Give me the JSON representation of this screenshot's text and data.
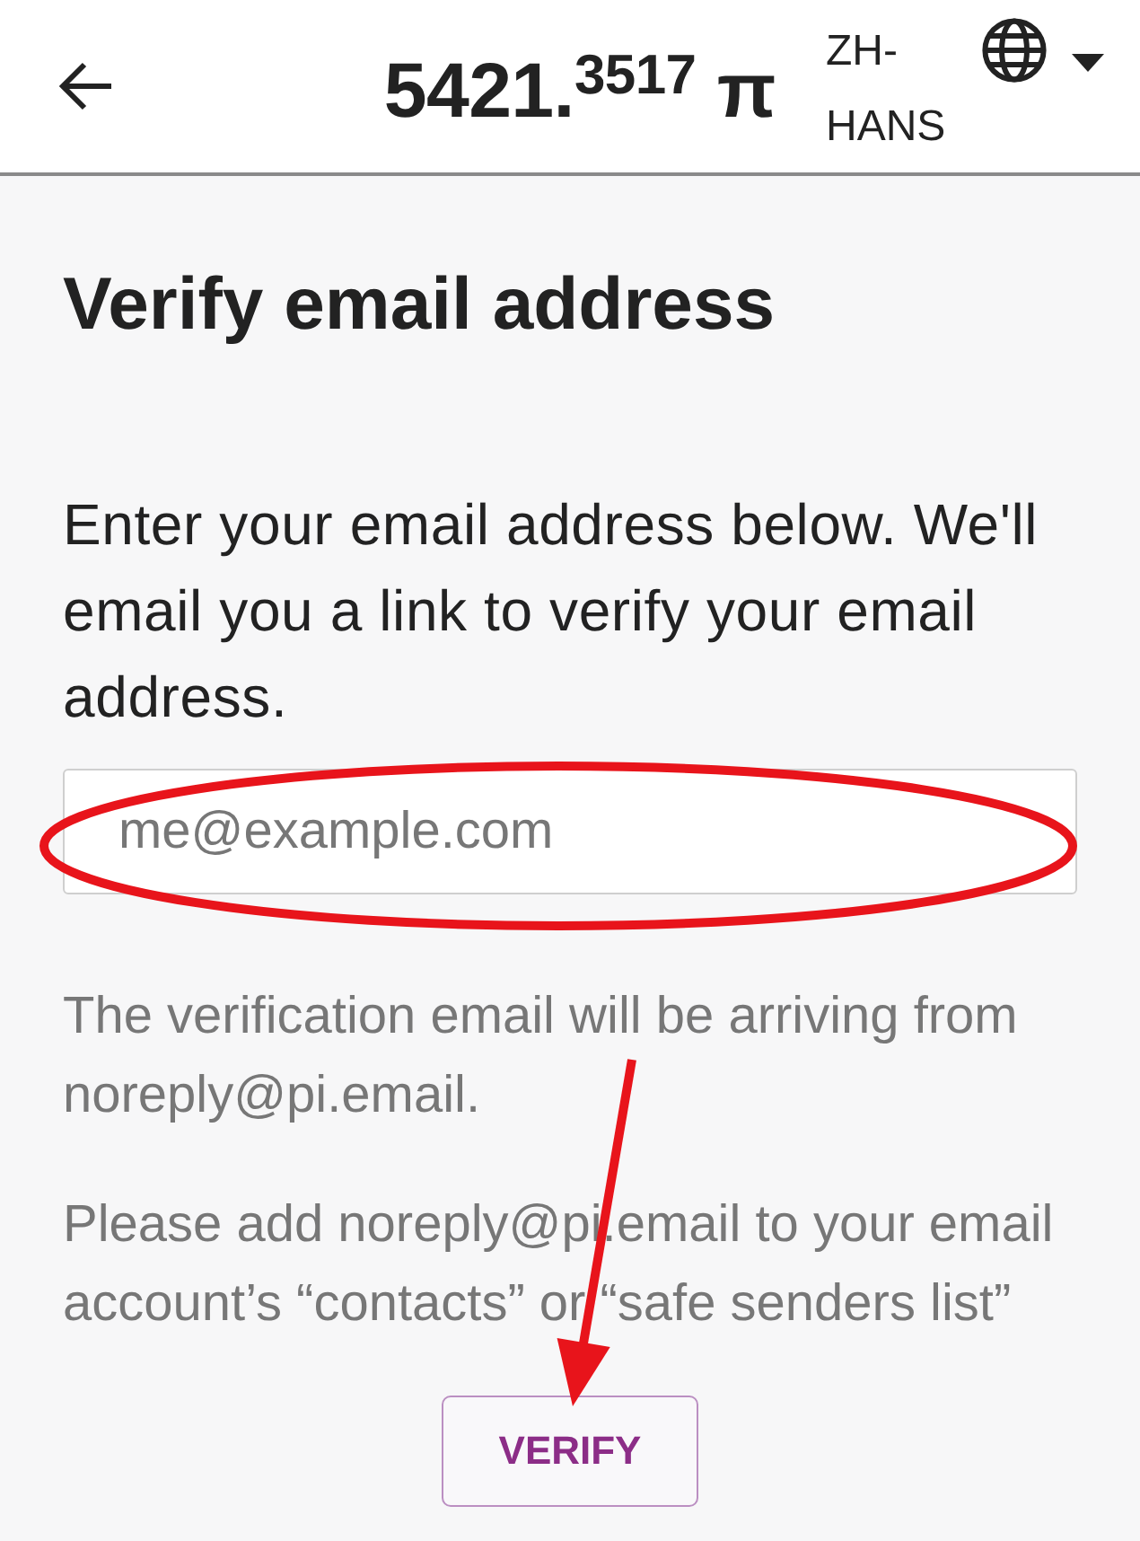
{
  "header": {
    "balance": "5421.$^{3517}$ π",
    "language": "ZH-HANS"
  },
  "page": {
    "title": "Verify email address",
    "intro": "Enter your email address below. We'll email you a link to verify your email address.",
    "email_field": {
      "placeholder": "me@example.com"
    },
    "notes": [
      "The verification email will be arriving from noreply@pi.email.",
      "Please add noreply@pi.email to your email account’s “contacts” or “safe senders list”"
    ],
    "button": "VERIFY"
  },
  "annotations": [
    {
      "kind": "ellipse"
    },
    {
      "kind": "arrow"
    }
  ]
}
